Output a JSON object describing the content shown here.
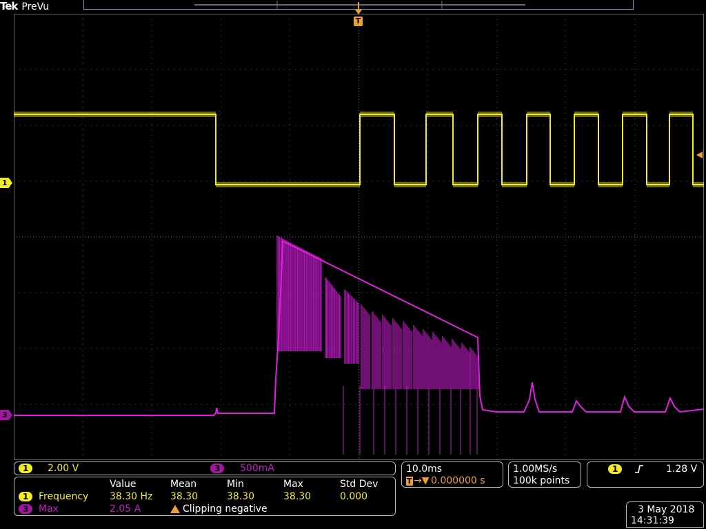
{
  "header": {
    "brand": "Tek",
    "mode": "PreVu"
  },
  "trigger_marker": "T",
  "colors": {
    "ch1": "#f2ec2b",
    "ch3": "#e020e0",
    "grid": "#555555",
    "trigger": "#f0a030"
  },
  "ch1_scale": {
    "channel": "1",
    "label": "2.00 V"
  },
  "ch3_scale": {
    "channel": "3",
    "label": "500mA"
  },
  "measurements": {
    "headers": [
      "Value",
      "Mean",
      "Min",
      "Max",
      "Std Dev"
    ],
    "row1": {
      "channel": "1",
      "name": "Frequency",
      "value": "38.30 Hz",
      "mean": "38.30",
      "min": "38.30",
      "max": "38.30",
      "std": "0.000"
    },
    "row2": {
      "channel": "3",
      "name": "Max",
      "value": "2.05 A",
      "warning": "Clipping negative"
    }
  },
  "horizontal": {
    "scale": "10.0ms",
    "position": "0.000000 s"
  },
  "acquisition": {
    "rate": "1.00MS/s",
    "points": "100k points"
  },
  "trigger": {
    "channel": "1",
    "level": "1.28 V"
  },
  "datetime": {
    "date": "3 May 2018",
    "time": "14:31:39"
  }
}
